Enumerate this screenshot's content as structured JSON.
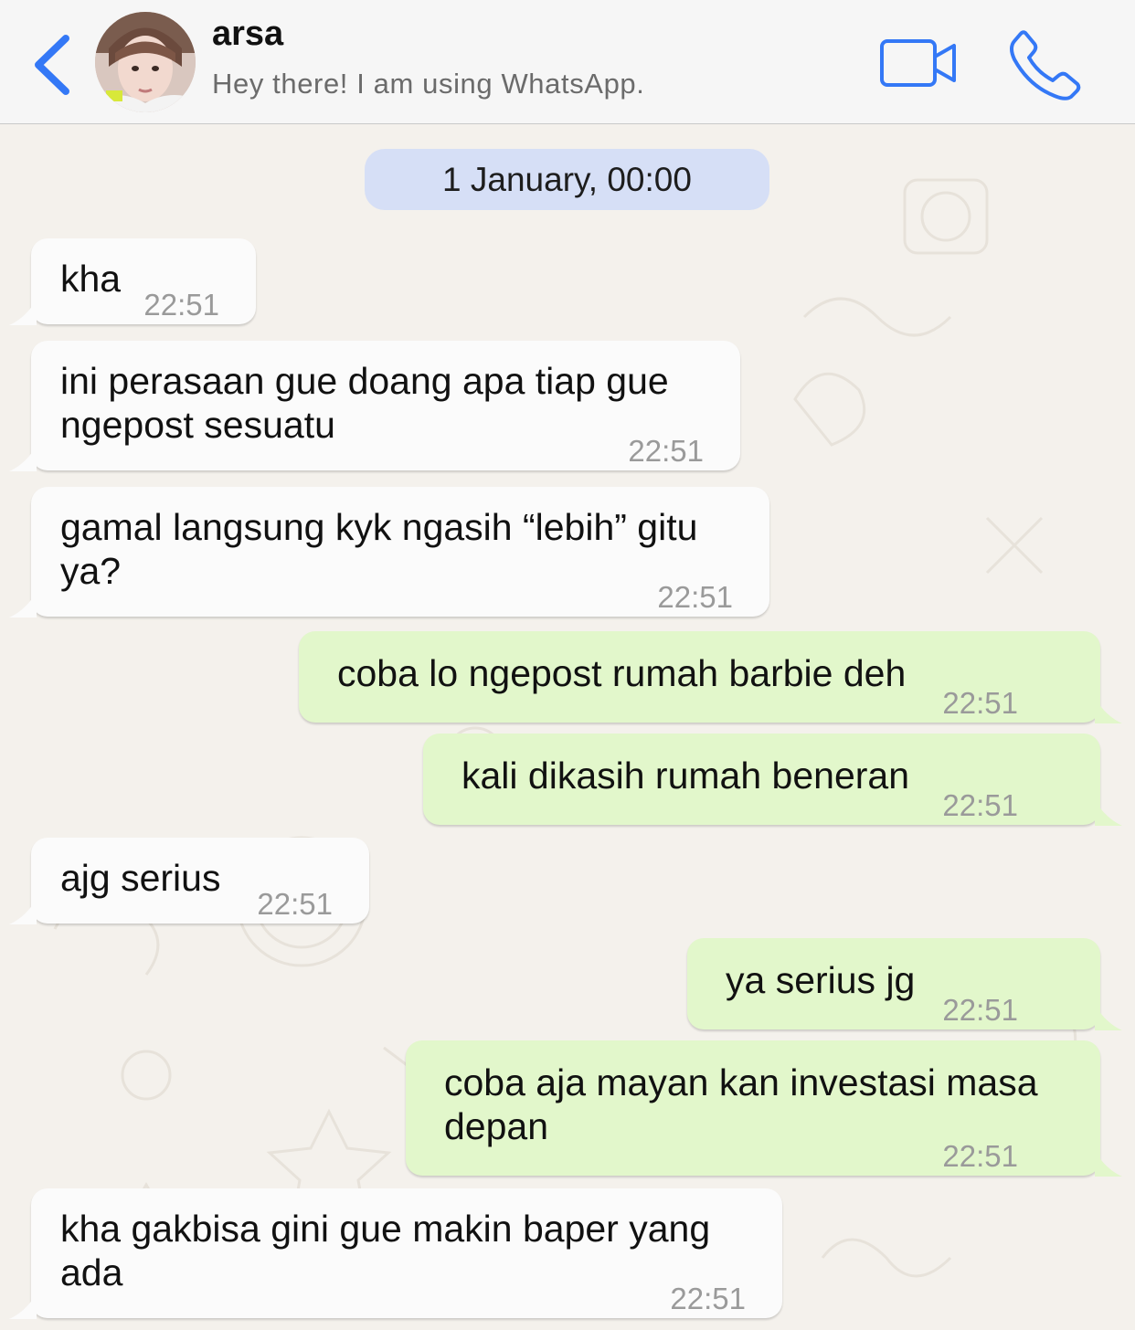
{
  "header": {
    "contact_name": "arsa",
    "contact_status": "Hey there! I am using WhatsApp.",
    "accent_color": "#3478f6"
  },
  "chat": {
    "date_label": "1 January, 00:00",
    "messages": [
      {
        "direction": "incoming",
        "lines": [
          "kha"
        ],
        "time": "22:51"
      },
      {
        "direction": "incoming",
        "lines": [
          "ini perasaan gue doang apa tiap gue",
          "ngepost sesuatu"
        ],
        "time": "22:51"
      },
      {
        "direction": "incoming",
        "lines": [
          "gamal langsung kyk ngasih “lebih” gitu",
          "ya?"
        ],
        "time": "22:51"
      },
      {
        "direction": "outgoing",
        "lines": [
          "coba lo ngepost rumah barbie deh"
        ],
        "time": "22:51"
      },
      {
        "direction": "outgoing",
        "lines": [
          "kali dikasih rumah beneran"
        ],
        "time": "22:51"
      },
      {
        "direction": "incoming",
        "lines": [
          "ajg serius"
        ],
        "time": "22:51"
      },
      {
        "direction": "outgoing",
        "lines": [
          "ya serius jg"
        ],
        "time": "22:51"
      },
      {
        "direction": "outgoing",
        "lines": [
          "coba aja mayan kan investasi masa",
          "depan"
        ],
        "time": "22:51"
      },
      {
        "direction": "incoming",
        "lines": [
          "kha gakbisa gini gue makin baper yang",
          "ada"
        ],
        "time": "22:51"
      }
    ]
  }
}
